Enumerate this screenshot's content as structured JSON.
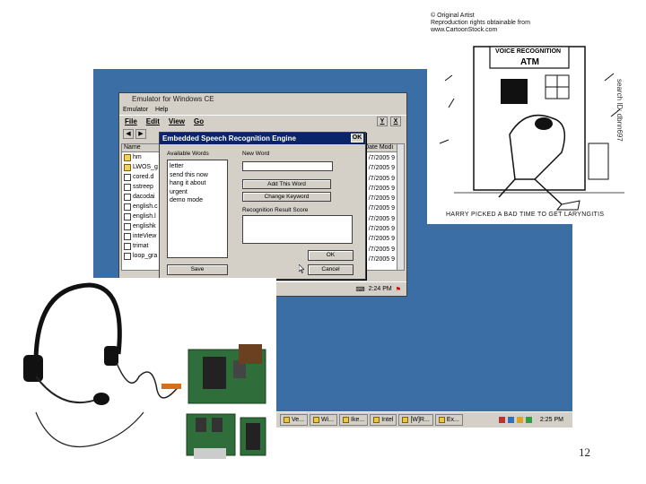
{
  "emulator": {
    "title": "Emulator for Windows CE",
    "menu_top": [
      "Emulator",
      "Help"
    ],
    "menu": [
      "File",
      "Edit",
      "View",
      "Go"
    ],
    "toolbar_right": [
      "Y",
      "X"
    ],
    "columns": [
      "Name",
      "Date Modi"
    ],
    "files": [
      {
        "name": "hm",
        "type": "folder"
      },
      {
        "name": "LWOS_g",
        "type": "folder"
      },
      {
        "name": "cored.d",
        "type": "doc"
      },
      {
        "name": "sstreep",
        "type": "doc"
      },
      {
        "name": "dacodai",
        "type": "doc"
      },
      {
        "name": "english.c",
        "type": "doc"
      },
      {
        "name": "english.l",
        "type": "doc"
      },
      {
        "name": "englishk",
        "type": "doc"
      },
      {
        "name": "inteView",
        "type": "doc"
      },
      {
        "name": "trimat",
        "type": "doc"
      },
      {
        "name": "loop_gra",
        "type": "doc"
      }
    ],
    "dates": [
      "/7/2005 9",
      "/7/2005 9",
      "/7/2005 9",
      "/7/2005 9",
      "/7/2005 9",
      "/7/2005 9",
      "/7/2005 9",
      "/7/2005 9",
      "/7/2005 9",
      "/7/2005 9",
      "/7/2005 9"
    ],
    "clock": "2:24 PM"
  },
  "dialog": {
    "title": "Embedded Speech Recognition Engine",
    "ok_corner": "OK",
    "available_label": "Available Words",
    "new_word_label": "New Word",
    "words": [
      "letter",
      "send this now",
      "hang it about",
      "urgent",
      "demo mode"
    ],
    "add_button": "Add This Word",
    "change_button": "Change Keyword",
    "result_label": "Recognition Result Score",
    "ok_button": "OK",
    "cancel_button": "Cancel",
    "save_button": "Save",
    "new_word_value": ""
  },
  "taskbar": {
    "items": [
      "Ve...",
      "Wi...",
      "Ike...",
      "Intel",
      "[W]R...",
      "Ex..."
    ],
    "clock": "2:25 PM"
  },
  "cartoon": {
    "credit": [
      "© Original Artist",
      "Reproduction rights obtainable from",
      "www.CartoonStock.com"
    ],
    "sign": "VOICE RECOGNITION",
    "sign2": "ATM",
    "search_id": "search ID: dbnn697",
    "caption": "HARRY PICKED A BAD TIME TO GET LARYNGITIS"
  },
  "page_number": "12",
  "colors": {
    "desktop": "#3a6ea5",
    "dialog_title": "#0a246a"
  }
}
